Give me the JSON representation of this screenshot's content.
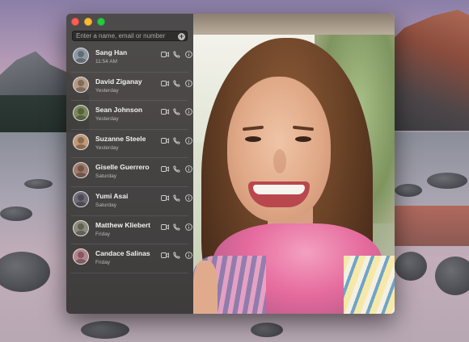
{
  "window": {
    "search": {
      "placeholder": "Enter a name, email or number"
    }
  },
  "contacts": [
    {
      "name": "Sang Han",
      "when": "11:54 AM",
      "avatar_color": "#8d9aa6"
    },
    {
      "name": "David Ziganay",
      "when": "Yesterday",
      "avatar_color": "#b59a84"
    },
    {
      "name": "Sean Johnson",
      "when": "Yesterday",
      "avatar_color": "#7c8a5a"
    },
    {
      "name": "Suzanne Steele",
      "when": "Yesterday",
      "avatar_color": "#c49a76"
    },
    {
      "name": "Giselle Guerrero",
      "when": "Saturday",
      "avatar_color": "#a07a6a"
    },
    {
      "name": "Yumi Asai",
      "when": "Saturday",
      "avatar_color": "#6f6a78"
    },
    {
      "name": "Matthew Kliebert",
      "when": "Friday",
      "avatar_color": "#8d8b7c"
    },
    {
      "name": "Candace Salinas",
      "when": "Friday",
      "avatar_color": "#b7838c"
    }
  ],
  "icons": {
    "video": "video-camera-icon",
    "phone": "phone-icon",
    "info": "info-icon",
    "add": "add-contact-icon"
  },
  "colors": {
    "close": "#fc5f57",
    "minimize": "#fdbc2e",
    "zoom": "#29c940"
  }
}
